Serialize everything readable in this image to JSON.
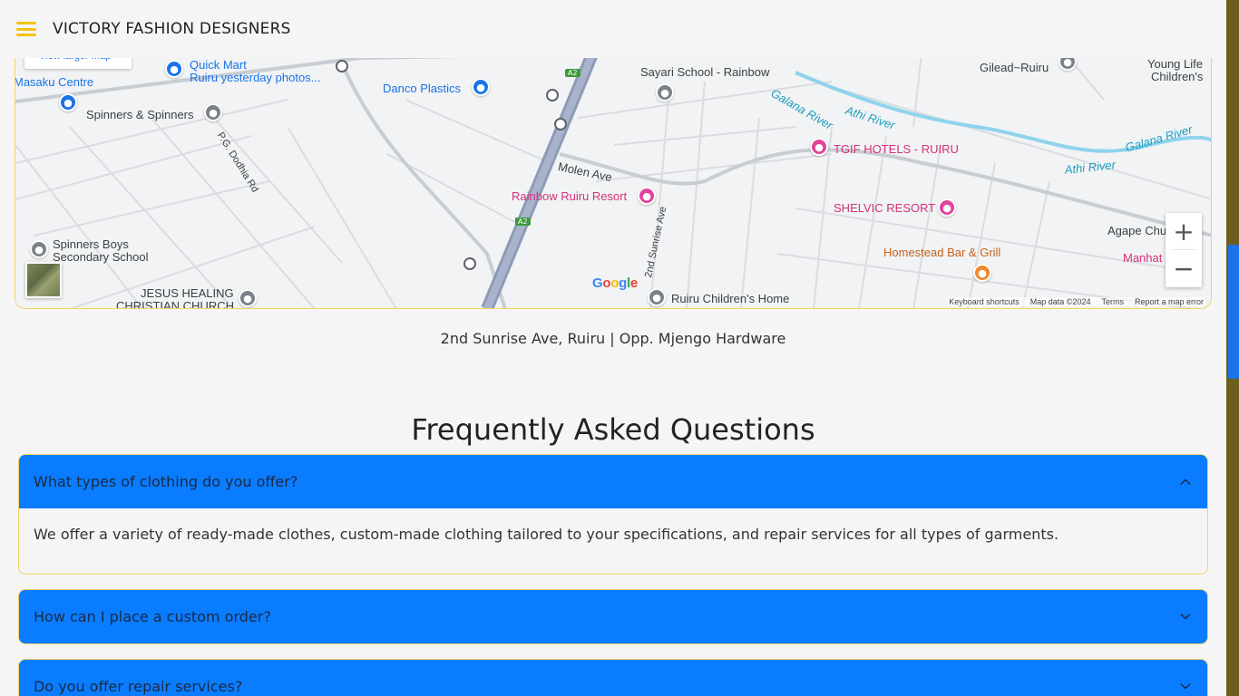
{
  "navbar": {
    "brand": "VICTORY FASHION DESIGNERS",
    "menu_icon": "hamburger-menu-icon",
    "accent_color": "#f3c412"
  },
  "map": {
    "view_larger_map": "View larger map",
    "labels": {
      "quick_mart": "Quick Mart",
      "quick_mart_sub": "Ruiru yesterday photos...",
      "masaku": "Masaku Centre",
      "spinners": "Spinners & Spinners",
      "danco": "Danco Plastics",
      "sayari": "Sayari School - Rainbow",
      "gilead": "Gilead~Ruiru",
      "young_life": "Young Life",
      "young_life_sub": "Children's",
      "galana_top": "Galana River",
      "athi_top": "Athi River",
      "galana_right": "Galana River",
      "athi_right": "Athi River",
      "pg_dodhia": "P.G. Dodhia Rd",
      "molen": "Molen Ave",
      "tgif": "TGIF HOTELS - RUIRU",
      "rainbow_resort": "Rainbow Ruiru Resort",
      "shelvic": "SHELVIC RESORT",
      "sunrise": "2nd Sunrise Ave",
      "agape": "Agape Chu",
      "homestead": "Homestead Bar & Grill",
      "manhat": "Manhat",
      "spinners_boys": "Spinners Boys",
      "spinners_boys_sub": "Secondary School",
      "jesus_healing": "JESUS HEALING",
      "jesus_healing_sub": "CHRISTIAN CHURCH",
      "childrens_home": "Ruiru Children's Home",
      "shield_a2": "A2"
    },
    "zoom_in": "+",
    "zoom_out": "−",
    "google": "Google",
    "attribution": {
      "shortcuts": "Keyboard shortcuts",
      "map_data": "Map data ©2024",
      "terms": "Terms",
      "report": "Report a map error"
    }
  },
  "address": "2nd Sunrise Ave, Ruiru | Opp. Mjengo Hardware",
  "faq": {
    "title": "Frequently Asked Questions",
    "items": [
      {
        "question": "What types of clothing do you offer?",
        "answer": "We offer a variety of ready-made clothes, custom-made clothing tailored to your specifications, and repair services for all types of garments.",
        "expanded": true
      },
      {
        "question": "How can I place a custom order?",
        "expanded": false
      },
      {
        "question": "Do you offer repair services?",
        "expanded": false
      }
    ],
    "header_color": "#0a7cff",
    "border_color": "#f3d36b"
  }
}
